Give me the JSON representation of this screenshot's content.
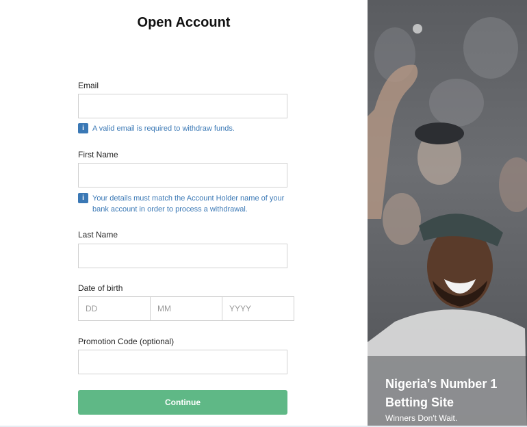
{
  "form": {
    "title": "Open Account",
    "email": {
      "label": "Email",
      "value": "",
      "hint": "A valid email is required to withdraw funds."
    },
    "first_name": {
      "label": "First Name",
      "value": "",
      "hint": "Your details must match the Account Holder name of your bank account in order to process a withdrawal."
    },
    "last_name": {
      "label": "Last Name",
      "value": ""
    },
    "dob": {
      "label": "Date of birth",
      "day_placeholder": "DD",
      "month_placeholder": "MM",
      "year_placeholder": "YYYY"
    },
    "promo": {
      "label": "Promotion Code (optional)",
      "value": ""
    },
    "info_icon_glyph": "i",
    "continue_label": "Continue"
  },
  "promo_panel": {
    "headline": "Nigeria's Number 1 Betting Site",
    "tagline": "Winners Don't Wait."
  },
  "colors": {
    "accent_green": "#5fb886",
    "hint_blue": "#3a78b5"
  }
}
